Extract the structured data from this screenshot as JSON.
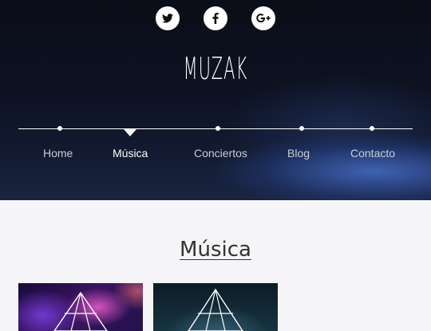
{
  "social": {
    "icons": [
      "twitter-icon",
      "facebook-icon",
      "google-plus-icon"
    ]
  },
  "site": {
    "logo": "MUZAK"
  },
  "nav": {
    "items": [
      {
        "label": "Home",
        "active": false
      },
      {
        "label": "Música",
        "active": true
      },
      {
        "label": "Conciertos",
        "active": false
      },
      {
        "label": "Blog",
        "active": false
      },
      {
        "label": "Contacto",
        "active": false
      }
    ]
  },
  "main": {
    "section_title": "Música"
  },
  "colors": {
    "hero_dark": "#0b0e18",
    "nav_text": "#c9ccd6",
    "nav_active": "#ffffff",
    "page_bg": "#f5f5f7",
    "title_text": "#333333"
  }
}
